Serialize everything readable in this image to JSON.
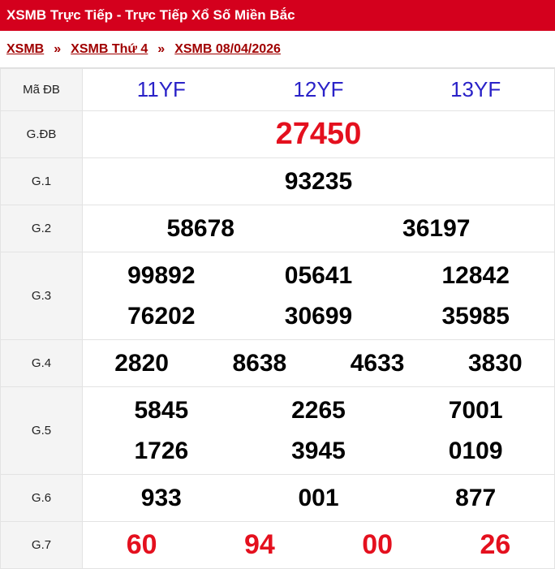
{
  "header": {
    "title": "XSMB Trực Tiếp - Trực Tiếp Xổ Số Miền Bắc"
  },
  "breadcrumb": [
    "XSMB",
    "XSMB Thứ 4",
    "XSMB 08/04/2026"
  ],
  "breadcrumb_sep": "»",
  "table": {
    "ma_db": {
      "label": "Mã ĐB",
      "codes": [
        "11YF",
        "12YF",
        "13YF"
      ]
    },
    "gdb": {
      "label": "G.ĐB",
      "values": [
        "27450"
      ]
    },
    "g1": {
      "label": "G.1",
      "values": [
        "93235"
      ]
    },
    "g2": {
      "label": "G.2",
      "values": [
        "58678",
        "36197"
      ]
    },
    "g3": {
      "label": "G.3",
      "values": [
        "99892",
        "05641",
        "12842",
        "76202",
        "30699",
        "35985"
      ]
    },
    "g4": {
      "label": "G.4",
      "values": [
        "2820",
        "8638",
        "4633",
        "3830"
      ]
    },
    "g5": {
      "label": "G.5",
      "values": [
        "5845",
        "2265",
        "7001",
        "1726",
        "3945",
        "0109"
      ]
    },
    "g6": {
      "label": "G.6",
      "values": [
        "933",
        "001",
        "877"
      ]
    },
    "g7": {
      "label": "G.7",
      "values": [
        "60",
        "94",
        "00",
        "26"
      ]
    }
  }
}
